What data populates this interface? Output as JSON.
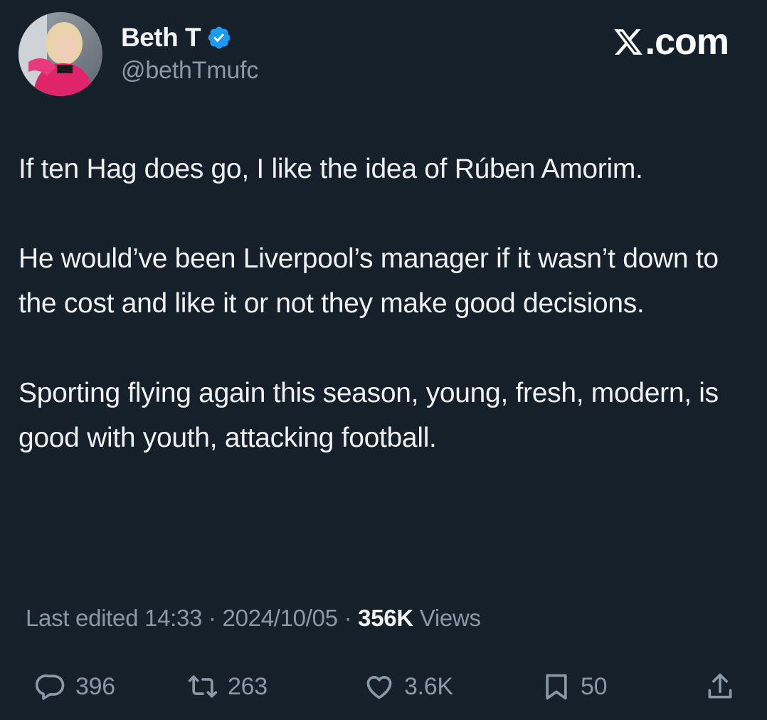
{
  "author": {
    "display_name": "Beth T",
    "handle": "@bethTmufc",
    "verified": true
  },
  "brand": {
    "label": ".com",
    "icon": "x-logo-icon"
  },
  "tweet": {
    "paragraphs": [
      "If ten Hag does go, I like the idea of Rúben Amorim.",
      "He would’ve been Liverpool’s manager if it wasn’t down to the cost and like it or not they make good decisions.",
      "Sporting flying again this season, young, fresh, modern, is good with youth, attacking football."
    ]
  },
  "meta": {
    "edited_label": "Last edited 14:33",
    "separator1": " · ",
    "date": "2024/10/05",
    "separator2": " · ",
    "views_count": "356K",
    "views_label": " Views"
  },
  "actions": {
    "replies": "396",
    "reposts": "263",
    "likes": "3.6K",
    "bookmarks": "50"
  },
  "colors": {
    "background": "#15202b",
    "text": "#e7e9ea",
    "secondary": "#8b98a5",
    "verified": "#1d9bf0"
  }
}
